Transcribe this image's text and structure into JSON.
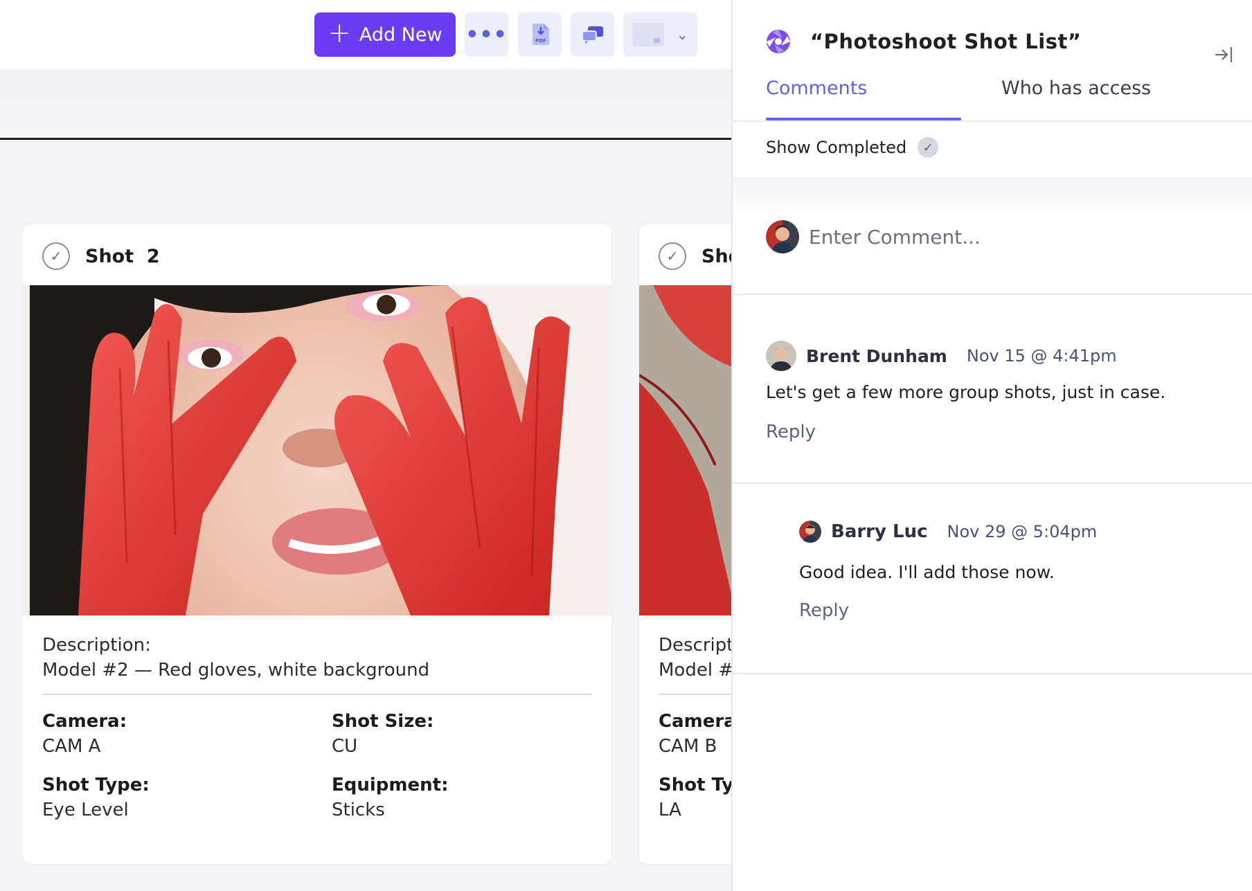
{
  "toolbar": {
    "add_new_label": "Add New",
    "add_icon": "plus-icon",
    "more_icon": "more-dots-icon",
    "pdf_icon": "pdf-download-icon",
    "pdf_badge": "PDF",
    "chat_icon": "chat-bubbles-icon",
    "view_icon": "view-thumbnail-icon",
    "view_chevron_icon": "chevron-down-icon"
  },
  "cards": [
    {
      "title": "Shot  2",
      "description_label": "Description:",
      "description": "Model #2 — Red gloves, white background",
      "fields": [
        {
          "label": "Camera:",
          "value": "CAM A"
        },
        {
          "label": "Shot Size:",
          "value": "CU"
        },
        {
          "label": "Shot Type:",
          "value": "Eye Level"
        },
        {
          "label": "Equipment:",
          "value": "Sticks"
        }
      ]
    },
    {
      "title": "Shot",
      "description_label": "Description:",
      "description": "Model #",
      "fields": [
        {
          "label": "Camera:",
          "value": "CAM B"
        },
        {
          "label": "Shot Type:",
          "value": "LA"
        }
      ]
    }
  ],
  "panel": {
    "title": "“Photoshoot Shot List”",
    "logo_icon": "aperture-logo-icon",
    "collapse_icon": "collapse-panel-icon",
    "tabs": [
      {
        "label": "Comments",
        "active": true
      },
      {
        "label": "Who has access",
        "active": false
      }
    ],
    "show_completed_label": "Show Completed",
    "compose_placeholder": "Enter Comment...",
    "comments": [
      {
        "author": "Brent Dunham",
        "time": "Nov 15 @ 4:41pm",
        "body": "Let's get a few more group shots, just in case.",
        "reply_label": "Reply"
      },
      {
        "author": "Barry Luc",
        "time": "Nov 29 @ 5:04pm",
        "body": "Good idea. I'll add those now.",
        "reply_label": "Reply"
      }
    ]
  },
  "colors": {
    "accent": "#6a3df5",
    "tab_active": "#5b63e6",
    "glove_red": "#e23a36"
  }
}
